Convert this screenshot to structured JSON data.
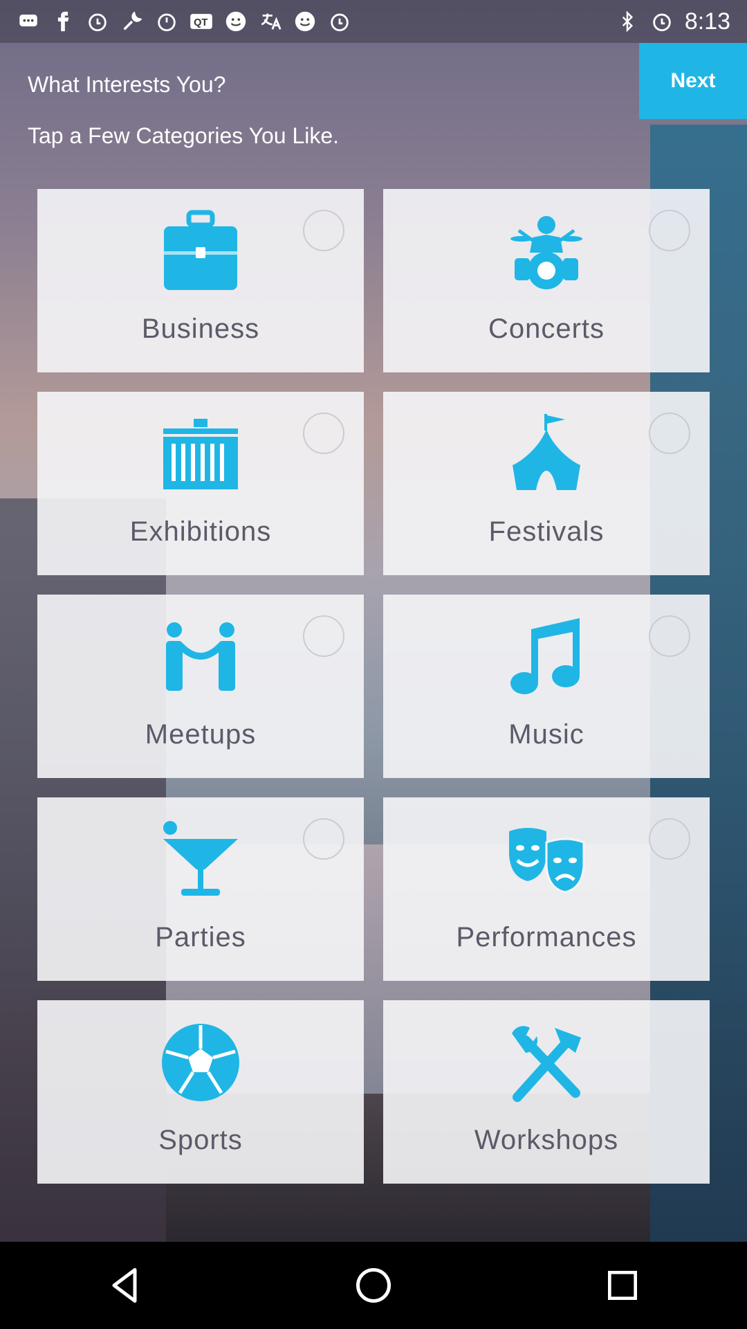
{
  "status_bar": {
    "time": "8:13",
    "notification_icons": [
      "messages-icon",
      "facebook-icon",
      "alarm-icon",
      "tool-icon",
      "timer-icon",
      "qt-icon",
      "emoji-icon",
      "translate-icon",
      "emoji-icon",
      "alarm-icon"
    ],
    "system_icons": [
      "bluetooth-icon",
      "alarm-icon"
    ]
  },
  "header": {
    "title": "What Interests You?",
    "subtitle": "Tap a Few Categories You Like.",
    "next_label": "Next"
  },
  "categories": [
    {
      "label": "Business",
      "icon": "briefcase-icon",
      "selected": false
    },
    {
      "label": "Concerts",
      "icon": "drummer-icon",
      "selected": false
    },
    {
      "label": "Exhibitions",
      "icon": "exhibition-icon",
      "selected": false
    },
    {
      "label": "Festivals",
      "icon": "tent-icon",
      "selected": false
    },
    {
      "label": "Meetups",
      "icon": "meetup-icon",
      "selected": false
    },
    {
      "label": "Music",
      "icon": "music-note-icon",
      "selected": false
    },
    {
      "label": "Parties",
      "icon": "cocktail-icon",
      "selected": false
    },
    {
      "label": "Performances",
      "icon": "theater-masks-icon",
      "selected": false
    },
    {
      "label": "Sports",
      "icon": "soccer-ball-icon",
      "selected": false
    },
    {
      "label": "Workshops",
      "icon": "tools-icon",
      "selected": false
    }
  ],
  "colors": {
    "accent": "#1fb6e6",
    "icon": "#1fb6e6",
    "tile_text": "#5a5a68"
  },
  "nav": [
    "back-icon",
    "home-icon",
    "recents-icon"
  ]
}
